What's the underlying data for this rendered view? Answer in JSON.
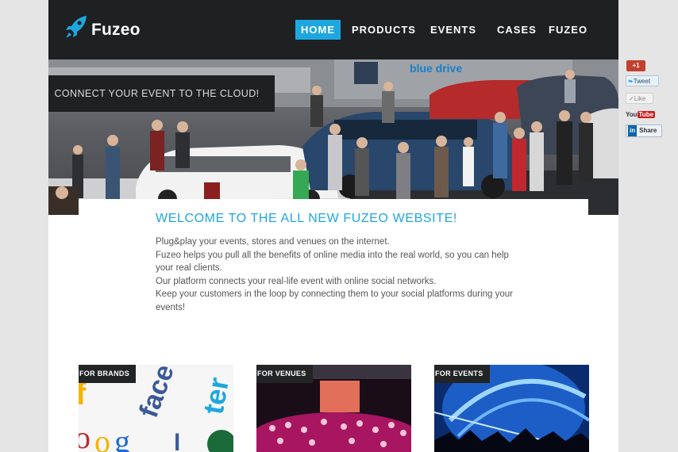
{
  "header": {
    "logo_text": "Fuzeo",
    "nav": [
      {
        "label": "HOME",
        "active": true
      },
      {
        "label": "PRODUCTS",
        "active": false
      },
      {
        "label": "EVENTS",
        "active": false
      },
      {
        "label": "CASES",
        "active": false
      },
      {
        "label": "FUZEO",
        "active": false
      }
    ]
  },
  "hero": {
    "tagline": "CONNECT YOUR EVENT TO THE CLOUD!",
    "image_icon": "car-show-photo",
    "banner_text": "blue drive"
  },
  "welcome": {
    "title": "WELCOME TO THE ALL NEW FUZEO WEBSITE!",
    "lines": [
      "Plug&play your events, stores and venues on the internet.",
      "Fuzeo helps you pull all the benefits of online media into the real world, so you can help your real clients.",
      "Our platform connects your real-life event with online social networks.",
      "Keep your customers in the loop by connecting them to your social platforms during your events!"
    ]
  },
  "tiles": [
    {
      "label": "FOR BRANDS",
      "image_icon": "social-logos-photo"
    },
    {
      "label": "FOR VENUES",
      "image_icon": "nightclub-photo"
    },
    {
      "label": "FOR EVENTS",
      "image_icon": "concert-photo"
    }
  ],
  "social": {
    "gplus": "+1",
    "tweet": "Tweet",
    "like": "Like",
    "youtube_you": "You",
    "youtube_tube": "Tube",
    "linkedin_in": "in",
    "share": "Share"
  },
  "colors": {
    "accent": "#1ea7df",
    "header_bg": "#1e2022",
    "page_bg": "#e5e5e5"
  }
}
